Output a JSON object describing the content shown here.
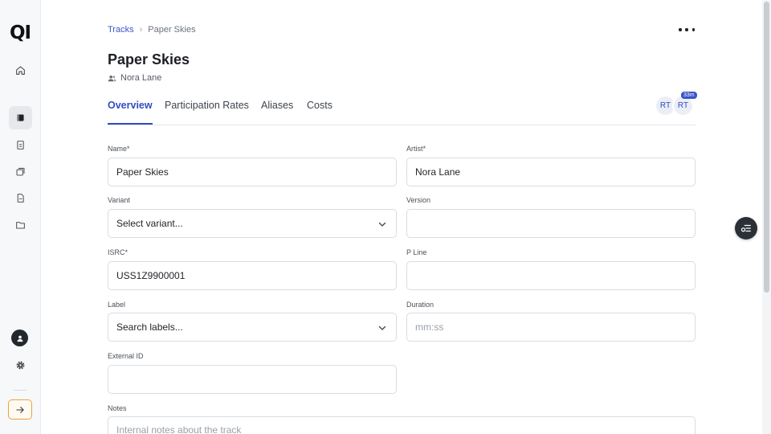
{
  "app": {
    "logo_text": "QI"
  },
  "sidebar": {
    "items": [
      {
        "icon": "home-icon"
      },
      {
        "icon": "tracks-icon",
        "active": true
      },
      {
        "icon": "document-icon"
      },
      {
        "icon": "stack-icon"
      },
      {
        "icon": "file-icon"
      },
      {
        "icon": "folder-icon"
      }
    ],
    "bottom": [
      {
        "icon": "user-icon"
      },
      {
        "icon": "gear-icon"
      },
      {
        "icon": "collapse-arrow-icon"
      }
    ]
  },
  "breadcrumb": {
    "parent": "Tracks",
    "separator": "›",
    "current": "Paper Skies"
  },
  "header": {
    "title": "Paper Skies",
    "artist": "Nora Lane"
  },
  "tabs": [
    {
      "label": "Overview",
      "active": true
    },
    {
      "label": "Participation Rates"
    },
    {
      "label": "Aliases"
    },
    {
      "label": "Costs"
    }
  ],
  "presence": {
    "users": [
      "RT",
      "RT"
    ],
    "badge": "33m"
  },
  "form": {
    "name": {
      "label": "Name*",
      "value": "Paper Skies"
    },
    "artist": {
      "label": "Artist*",
      "value": "Nora Lane"
    },
    "variant": {
      "label": "Variant",
      "value": "Select variant..."
    },
    "version": {
      "label": "Version",
      "value": ""
    },
    "isrc": {
      "label": "ISRC*",
      "value": "USS1Z9900001"
    },
    "pline": {
      "label": "P Line",
      "value": ""
    },
    "label": {
      "label": "Label",
      "value": "Search labels..."
    },
    "duration": {
      "label": "Duration",
      "placeholder": "mm:ss"
    },
    "external_id": {
      "label": "External ID",
      "value": ""
    },
    "notes": {
      "label": "Notes",
      "placeholder": "Internal notes about the track"
    }
  },
  "colors": {
    "accent": "#2f4ec4",
    "collapse_border": "#e8a33d"
  }
}
